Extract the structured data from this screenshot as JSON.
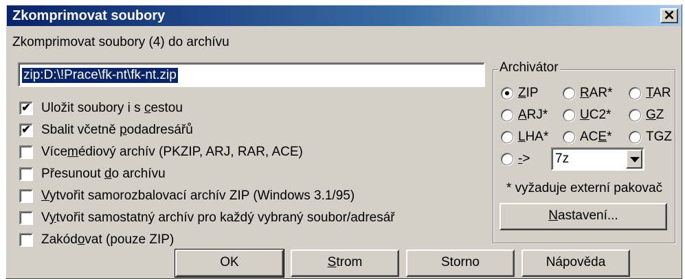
{
  "window": {
    "title": "Zkomprimovat soubory",
    "close_glyph": "✕"
  },
  "header_label": "Zkomprimovat soubory (4) do archívu",
  "path_value": "zip:D:\\!Prace\\fk-nt\\fk-nt.zip",
  "checkboxes": [
    {
      "pre": "Uložit soubory i s ",
      "ul": "c",
      "post": "estou",
      "checked": true
    },
    {
      "pre": "Sbalit včetně ",
      "ul": "p",
      "post": "odadresářů",
      "checked": true
    },
    {
      "pre": "Více",
      "ul": "m",
      "post": "édiový archív (PKZIP, ARJ, RAR, ACE)",
      "checked": false
    },
    {
      "pre": "Přesunout ",
      "ul": "d",
      "post": "o archívu",
      "checked": false
    },
    {
      "pre": "",
      "ul": "V",
      "post": "ytvořit samorozbalovací archív ZIP (Windows 3.1/95)",
      "checked": false
    },
    {
      "pre": "V",
      "ul": "y",
      "post": "tvořit samostatný archív pro každý vybraný soubor/adresář",
      "checked": false
    },
    {
      "pre": "Zakód",
      "ul": "o",
      "post": "vat (pouze ZIP)",
      "checked": false
    }
  ],
  "archiver": {
    "title": "Archivátor",
    "radios": [
      {
        "pre": "",
        "ul": "Z",
        "post": "IP",
        "selected": true
      },
      {
        "pre": "",
        "ul": "R",
        "post": "AR*",
        "selected": false
      },
      {
        "pre": "",
        "ul": "T",
        "post": "AR",
        "selected": false
      },
      {
        "pre": "",
        "ul": "A",
        "post": "RJ*",
        "selected": false
      },
      {
        "pre": "",
        "ul": "U",
        "post": "C2*",
        "selected": false
      },
      {
        "pre": "",
        "ul": "G",
        "post": "Z",
        "selected": false
      },
      {
        "pre": "",
        "ul": "L",
        "post": "HA*",
        "selected": false
      },
      {
        "pre": "AC",
        "ul": "E",
        "post": "*",
        "selected": false
      },
      {
        "pre": "",
        "ul": "",
        "post": "TGZ",
        "selected": false
      },
      {
        "pre": "",
        "ul": "-",
        "post": ">",
        "selected": false
      }
    ],
    "combo_value": "7z",
    "note": "* vyžaduje externí pakovač",
    "settings": {
      "pre": "",
      "ul": "N",
      "post": "astavení..."
    }
  },
  "buttons": {
    "ok": {
      "pre": "OK",
      "ul": "",
      "post": ""
    },
    "tree": {
      "pre": "",
      "ul": "S",
      "post": "trom"
    },
    "cancel": {
      "pre": "Storno",
      "ul": "",
      "post": ""
    },
    "help": {
      "pre": "Nápověda",
      "ul": "",
      "post": ""
    }
  }
}
